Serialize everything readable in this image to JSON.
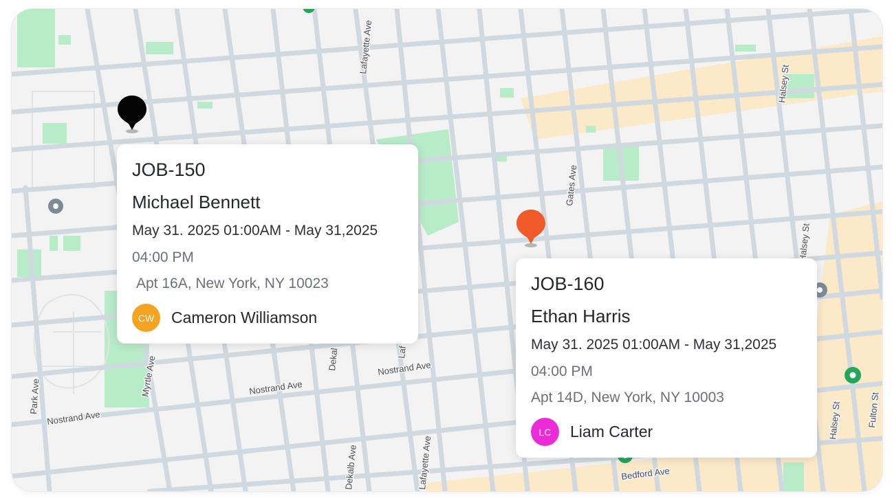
{
  "map": {
    "colors": {
      "background": "#f3f3f3",
      "road": "#d1d9e0",
      "park": "#b8ecc9",
      "commercial": "#fbe9c8",
      "poi": "#23a55a"
    },
    "streets": {
      "lafayette_top": "Lafayette Ave",
      "lafayette_bottom": "Lafayette Ave",
      "gates": "Gates Ave",
      "halsey_top": "Halsey St",
      "halsey_mid": "Halsey St",
      "halsey_bottom": "Halsey St",
      "myrtle": "Myrtle Ave",
      "nostrand_1": "Nostrand Ave",
      "nostrand_2": "Nostrand Ave",
      "nostrand_3": "Nostrand Ave",
      "park": "Park Ave",
      "dekalb_top": "Dekal",
      "dekalb_bottom": "Dekalb Ave",
      "laf_mid": "Laf",
      "bedford": "Bedford Ave",
      "fulton": "Fulton St"
    }
  },
  "jobs": [
    {
      "id": "JOB-150",
      "customer": "Michael Bennett",
      "time_line1": "May 31. 2025 01:00AM - May 31,2025",
      "time_line2": "04:00 PM",
      "address": "Apt 16A, New York, NY 10023",
      "technician": {
        "initials": "CW",
        "name": "Cameron Williamson",
        "color": "#f4a422"
      },
      "pin_color": "#050505"
    },
    {
      "id": "JOB-160",
      "customer": "Ethan Harris",
      "time_line1": "May 31. 2025 01:00AM - May 31,2025",
      "time_line2": "04:00 PM",
      "address": "Apt 14D, New York, NY 10003",
      "technician": {
        "initials": "LC",
        "name": "Liam Carter",
        "color": "#ea2bd7"
      },
      "pin_color": "#f05a2a"
    }
  ]
}
